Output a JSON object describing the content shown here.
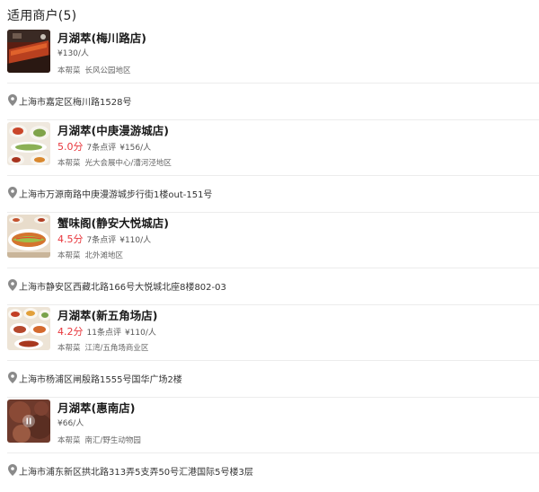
{
  "header": {
    "title": "适用商户(5)"
  },
  "merchants": [
    {
      "name": "月湖萃(梅川路店)",
      "score": "",
      "reviews": "",
      "price": "¥130/人",
      "cuisine": "本帮菜",
      "area": "长风公园地区",
      "address": "上海市嘉定区梅川路1528号",
      "thumb_icon": "grilled-meat-photo"
    },
    {
      "name": "月湖萃(中庚漫游城店)",
      "score": "5.0分",
      "reviews": "7条点评",
      "price": "¥156/人",
      "cuisine": "本帮菜",
      "area": "光大会展中心/漕河泾地区",
      "address": "上海市万源南路中庚漫游城步行街1楼out-151号",
      "thumb_icon": "dishes-photo"
    },
    {
      "name": "蟹味阁(静安大悦城店)",
      "score": "4.5分",
      "reviews": "7条点评",
      "price": "¥110/人",
      "cuisine": "本帮菜",
      "area": "北外滩地区",
      "address": "上海市静安区西藏北路166号大悦城北座8楼802-03",
      "thumb_icon": "fish-dish-photo"
    },
    {
      "name": "月湖萃(新五角场店)",
      "score": "4.2分",
      "reviews": "11条点评",
      "price": "¥110/人",
      "cuisine": "本帮菜",
      "area": "江湾/五角场商业区",
      "address": "上海市杨浦区闸殷路1555号国华广场2楼",
      "thumb_icon": "table-spread-photo"
    },
    {
      "name": "月湖萃(惠南店)",
      "score": "",
      "reviews": "",
      "price": "¥66/人",
      "cuisine": "本帮菜",
      "area": "南汇/野生动物园",
      "address": "上海市浦东新区拱北路313弄5支弄50号汇港国际5号楼3层",
      "thumb_icon": "blurred-video-thumbnail"
    }
  ],
  "colors": {
    "score": "#e8363c",
    "divider": "#ececec",
    "pin": "#8a8a8a"
  }
}
